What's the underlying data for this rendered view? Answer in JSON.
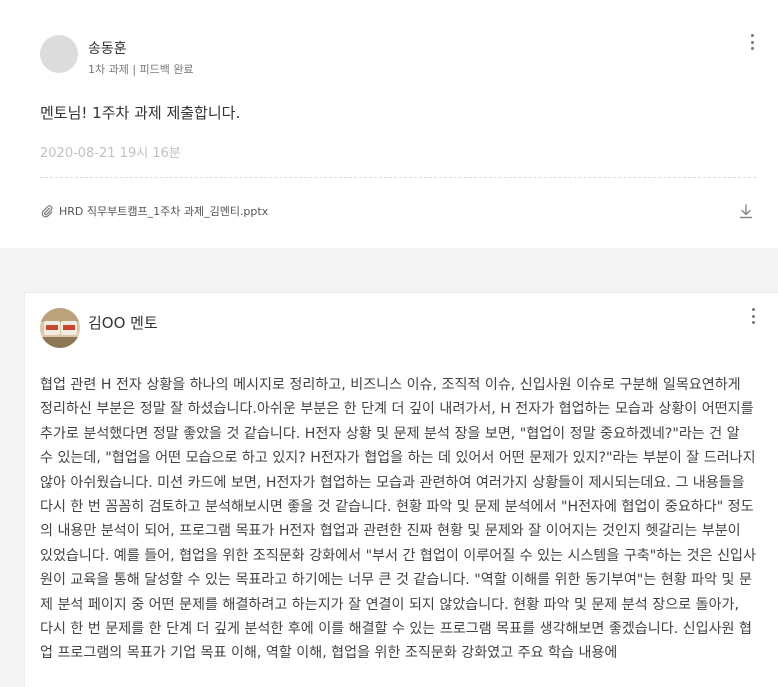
{
  "post": {
    "author_name": "송동훈",
    "author_sub": "1차 과제 | 피드백 완료",
    "body": "멘토님! 1주차 과제 제출합니다.",
    "timestamp": "2020-08-21 19시 16분",
    "attachment_name": "HRD 직무부트캠프_1주차 과제_김멘티.pptx"
  },
  "comment": {
    "author_name": "김OO 멘토",
    "text": "협업 관련 H 전자 상황을 하나의 메시지로 정리하고, 비즈니스 이슈, 조직적 이슈, 신입사원 이슈로 구분해 일목요연하게 정리하신 부분은 정말 잘 하셨습니다.아쉬운 부분은 한 단계 더 깊이 내려가서, H 전자가 협업하는 모습과 상황이 어떤지를 추가로 분석했다면 정말 좋았을 것 같습니다. H전자 상황 및 문제 분석 장을 보면, \"협업이 정말 중요하겠네?\"라는 건 알 수 있는데, \"협업을 어떤 모습으로 하고 있지? H전자가 협업을 하는 데 있어서 어떤 문제가 있지?\"라는 부분이 잘 드러나지 않아 아쉬웠습니다. 미션 카드에 보면, H전자가 협업하는 모습과 관련하여 여러가지 상황들이 제시되는데요. 그 내용들을 다시 한 번 꼼꼼히 검토하고 분석해보시면 좋을 것 같습니다. 현황 파악 및 문제 분석에서 \"H전자에 협업이 중요하다\" 정도의 내용만 분석이 되어, 프로그램 목표가 H전자 협업과 관련한 진짜 현황 및 문제와 잘 이어지는 것인지 헷갈리는 부분이 있었습니다. 예를 들어, 협업을 위한 조직문화 강화에서 \"부서 간 협업이 이루어질 수 있는 시스템을 구축\"하는 것은 신입사원이 교육을 통해 달성할 수 있는 목표라고 하기에는 너무 큰 것 같습니다. \"역할 이해를 위한 동기부여\"는 현황 파악 및 문제 분석 페이지 중 어떤 문제를 해결하려고 하는지가 잘 연결이 되지 않았습니다. 현황 파악 및 문제 분석 장으로 돌아가, 다시 한 번 문제를 한 단계 더 깊게 분석한 후에 이를 해결할 수 있는 프로그램 목표를 생각해보면 좋겠습니다. 신입사원 협업 프로그램의 목표가 기업 목표 이해, 역할 이해, 협업을 위한 조직문화 강화였고 주요 학습 내용에"
  },
  "icons": {
    "more": "kebab-menu-icon",
    "attachment": "paperclip-icon",
    "download": "download-icon",
    "mentor_avatar": "mentor-avatar-image"
  },
  "colors": {
    "background": "#f4f4f4",
    "card": "#ffffff",
    "timestamp": "#c2c2c2"
  }
}
